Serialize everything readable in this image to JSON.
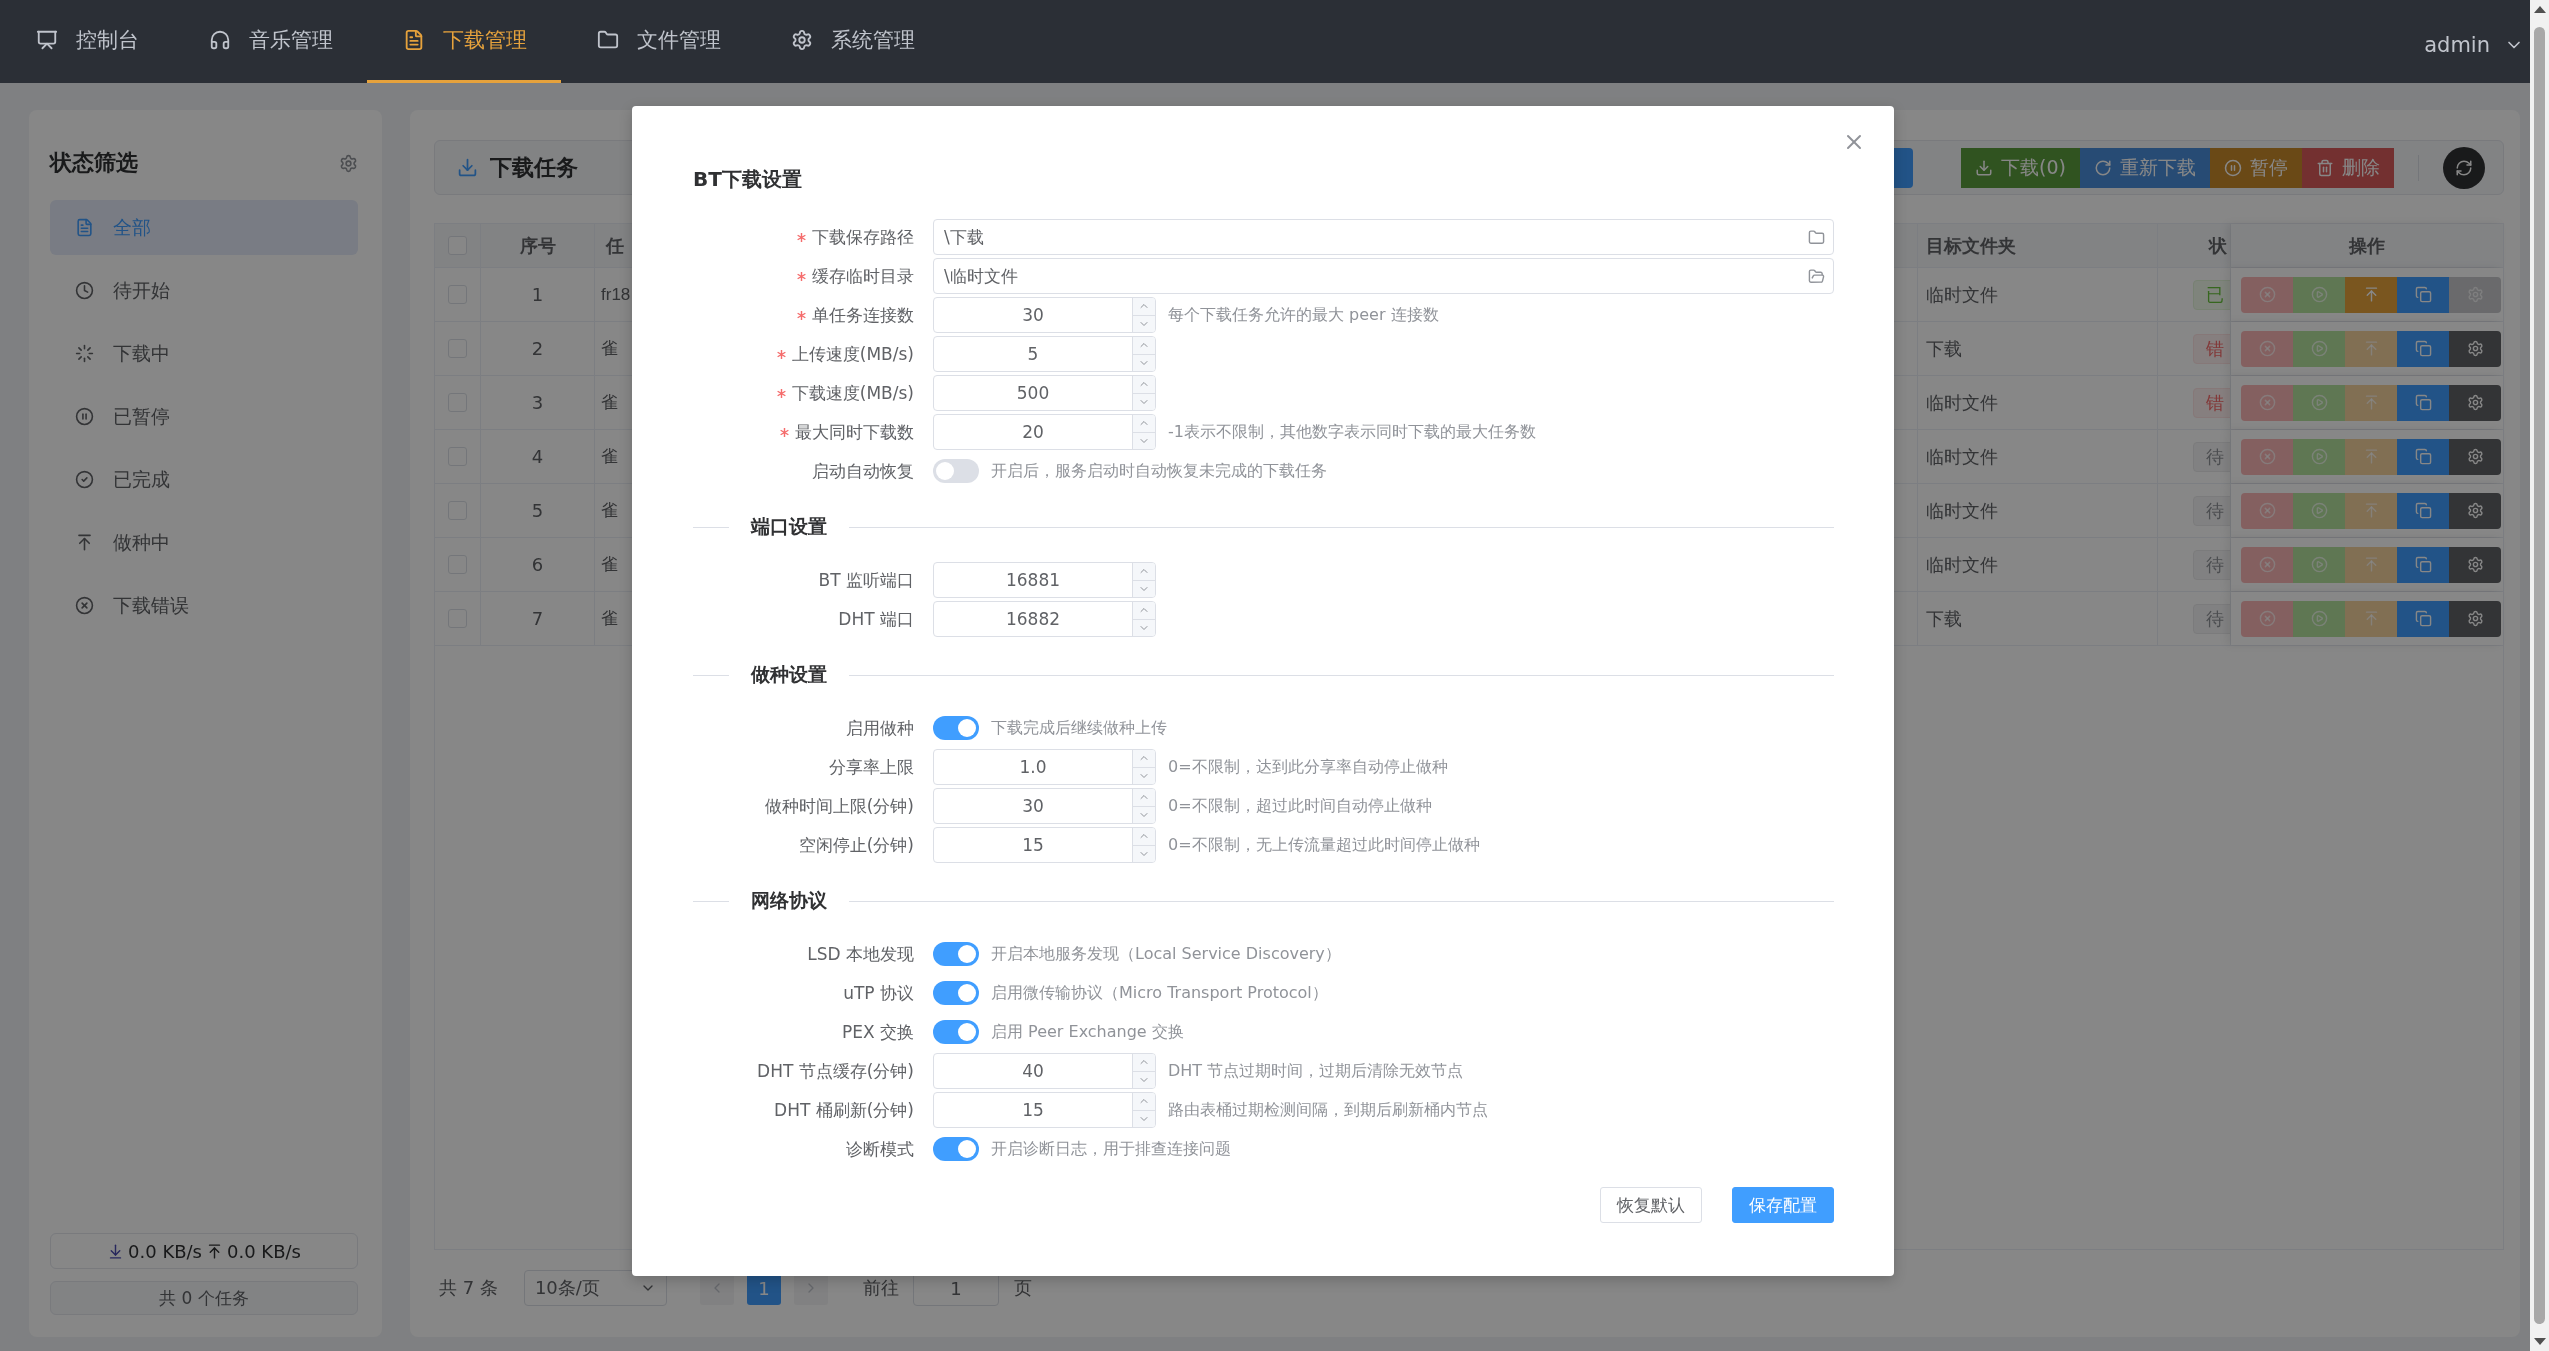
{
  "nav": {
    "items": [
      {
        "label": "控制台",
        "selected": false
      },
      {
        "label": "音乐管理",
        "selected": false
      },
      {
        "label": "下载管理",
        "selected": true
      },
      {
        "label": "文件管理",
        "selected": false
      },
      {
        "label": "系统管理",
        "selected": false
      }
    ],
    "user": "admin"
  },
  "sidebar": {
    "title": "状态筛选",
    "items": [
      {
        "label": "全部",
        "selected": true
      },
      {
        "label": "待开始",
        "selected": false
      },
      {
        "label": "下载中",
        "selected": false
      },
      {
        "label": "已暂停",
        "selected": false
      },
      {
        "label": "已完成",
        "selected": false
      },
      {
        "label": "做种中",
        "selected": false
      },
      {
        "label": "下载错误",
        "selected": false
      }
    ],
    "speed_down": "0.0 KB/s",
    "speed_up": "0.0 KB/s",
    "task_count": "共 0 个任务"
  },
  "toolbar": {
    "title": "下载任务",
    "buttons": [
      {
        "kind": "download",
        "label": "下载(0)",
        "disabled": true
      },
      {
        "kind": "redownload",
        "label": "重新下载",
        "disabled": true
      },
      {
        "kind": "pause",
        "label": "暂停",
        "disabled": true
      },
      {
        "kind": "delete",
        "label": "删除",
        "disabled": true
      }
    ]
  },
  "table": {
    "columns": [
      "序号",
      "任",
      "目标文件夹",
      "状",
      "操作"
    ],
    "header_checked": false,
    "rows": [
      {
        "checked": false,
        "index": "1",
        "name": "fr18",
        "folder": "临时文件",
        "status": {
          "text": "已",
          "kind": "done"
        },
        "actions": [
          {
            "kind": "cancel",
            "disabled": true
          },
          {
            "kind": "start",
            "disabled": true
          },
          {
            "kind": "seed",
            "disabled": false
          },
          {
            "kind": "copy",
            "disabled": false
          },
          {
            "kind": "settings",
            "disabled": true
          }
        ]
      },
      {
        "checked": false,
        "index": "2",
        "name": "雀",
        "folder": "下载",
        "status": {
          "text": "错",
          "kind": "error"
        },
        "actions": [
          {
            "kind": "cancel",
            "disabled": true
          },
          {
            "kind": "start",
            "disabled": true
          },
          {
            "kind": "seed",
            "disabled": true
          },
          {
            "kind": "copy",
            "disabled": false
          },
          {
            "kind": "settings",
            "disabled": false
          }
        ]
      },
      {
        "checked": false,
        "index": "3",
        "name": "雀",
        "folder": "临时文件",
        "status": {
          "text": "错",
          "kind": "error"
        },
        "actions": [
          {
            "kind": "cancel",
            "disabled": true
          },
          {
            "kind": "start",
            "disabled": true
          },
          {
            "kind": "seed",
            "disabled": true
          },
          {
            "kind": "copy",
            "disabled": false
          },
          {
            "kind": "settings",
            "disabled": false
          }
        ]
      },
      {
        "checked": false,
        "index": "4",
        "name": "雀",
        "folder": "临时文件",
        "status": {
          "text": "待",
          "kind": "pending"
        },
        "actions": [
          {
            "kind": "cancel",
            "disabled": true
          },
          {
            "kind": "start",
            "disabled": true
          },
          {
            "kind": "seed",
            "disabled": true
          },
          {
            "kind": "copy",
            "disabled": false
          },
          {
            "kind": "settings",
            "disabled": false
          }
        ]
      },
      {
        "checked": false,
        "index": "5",
        "name": "雀",
        "folder": "临时文件",
        "status": {
          "text": "待",
          "kind": "pending"
        },
        "actions": [
          {
            "kind": "cancel",
            "disabled": true
          },
          {
            "kind": "start",
            "disabled": true
          },
          {
            "kind": "seed",
            "disabled": true
          },
          {
            "kind": "copy",
            "disabled": false
          },
          {
            "kind": "settings",
            "disabled": false
          }
        ]
      },
      {
        "checked": false,
        "index": "6",
        "name": "雀",
        "folder": "临时文件",
        "status": {
          "text": "待",
          "kind": "pending"
        },
        "actions": [
          {
            "kind": "cancel",
            "disabled": true
          },
          {
            "kind": "start",
            "disabled": true
          },
          {
            "kind": "seed",
            "disabled": true
          },
          {
            "kind": "copy",
            "disabled": false
          },
          {
            "kind": "settings",
            "disabled": false
          }
        ]
      },
      {
        "checked": false,
        "index": "7",
        "name": "雀",
        "folder": "下载",
        "status": {
          "text": "待",
          "kind": "pending"
        },
        "actions": [
          {
            "kind": "cancel",
            "disabled": true
          },
          {
            "kind": "start",
            "disabled": true
          },
          {
            "kind": "seed",
            "disabled": true
          },
          {
            "kind": "copy",
            "disabled": false
          },
          {
            "kind": "settings",
            "disabled": false
          }
        ]
      }
    ]
  },
  "pagination": {
    "total": "共 7 条",
    "page_size": "10条/页",
    "pages": [
      {
        "label": "1",
        "selected": true
      }
    ],
    "goto_label": "前往",
    "goto_value": "1",
    "page_unit": "页"
  },
  "dialog": {
    "title": "BT下载设置",
    "sections": [
      {
        "fields": [
          {
            "kind": "path",
            "label": "下载保存路径",
            "required": true,
            "value": "\\下载"
          },
          {
            "kind": "path",
            "label": "缓存临时目录",
            "required": true,
            "value": "\\临时文件"
          },
          {
            "kind": "number",
            "label": "单任务连接数",
            "required": true,
            "value": "30",
            "hint": "每个下载任务允许的最大 peer 连接数"
          },
          {
            "kind": "number",
            "label": "上传速度(MB/s)",
            "required": true,
            "value": "5"
          },
          {
            "kind": "number",
            "label": "下载速度(MB/s)",
            "required": true,
            "value": "500"
          },
          {
            "kind": "number",
            "label": "最大同时下载数",
            "required": true,
            "value": "20",
            "hint": "-1表示不限制，其他数字表示同时下载的最大任务数"
          },
          {
            "kind": "switch",
            "label": "启动自动恢复",
            "required": false,
            "on": false,
            "hint": "开启后，服务启动时自动恢复未完成的下载任务"
          }
        ]
      },
      {
        "title": "端口设置",
        "fields": [
          {
            "kind": "number",
            "label": "BT 监听端口",
            "required": false,
            "value": "16881"
          },
          {
            "kind": "number",
            "label": "DHT 端口",
            "required": false,
            "value": "16882"
          }
        ]
      },
      {
        "title": "做种设置",
        "fields": [
          {
            "kind": "switch",
            "label": "启用做种",
            "required": false,
            "on": true,
            "hint": "下载完成后继续做种上传"
          },
          {
            "kind": "number",
            "label": "分享率上限",
            "required": false,
            "value": "1.0",
            "hint": "0=不限制，达到此分享率自动停止做种"
          },
          {
            "kind": "number",
            "label": "做种时间上限(分钟)",
            "required": false,
            "value": "30",
            "hint": "0=不限制，超过此时间自动停止做种"
          },
          {
            "kind": "number",
            "label": "空闲停止(分钟)",
            "required": false,
            "value": "15",
            "hint": "0=不限制，无上传流量超过此时间停止做种"
          }
        ]
      },
      {
        "title": "网络协议",
        "fields": [
          {
            "kind": "switch",
            "label": "LSD 本地发现",
            "required": false,
            "on": true,
            "hint": "开启本地服务发现（Local Service Discovery）"
          },
          {
            "kind": "switch",
            "label": "uTP 协议",
            "required": false,
            "on": true,
            "hint": "启用微传输协议（Micro Transport Protocol）"
          },
          {
            "kind": "switch",
            "label": "PEX 交换",
            "required": false,
            "on": true,
            "hint": "启用 Peer Exchange 交换"
          },
          {
            "kind": "number",
            "label": "DHT 节点缓存(分钟)",
            "required": false,
            "value": "40",
            "hint": "DHT 节点过期时间，过期后清除无效节点"
          },
          {
            "kind": "number",
            "label": "DHT 桶刷新(分钟)",
            "required": false,
            "value": "15",
            "hint": "路由表桶过期检测间隔，到期后刷新桶内节点"
          },
          {
            "kind": "switch",
            "label": "诊断模式",
            "required": false,
            "on": true,
            "hint": "开启诊断日志，用于排查连接问题"
          }
        ]
      }
    ],
    "buttons": [
      {
        "kind": "default",
        "label": "恢复默认"
      },
      {
        "kind": "primary",
        "label": "保存配置"
      }
    ]
  }
}
